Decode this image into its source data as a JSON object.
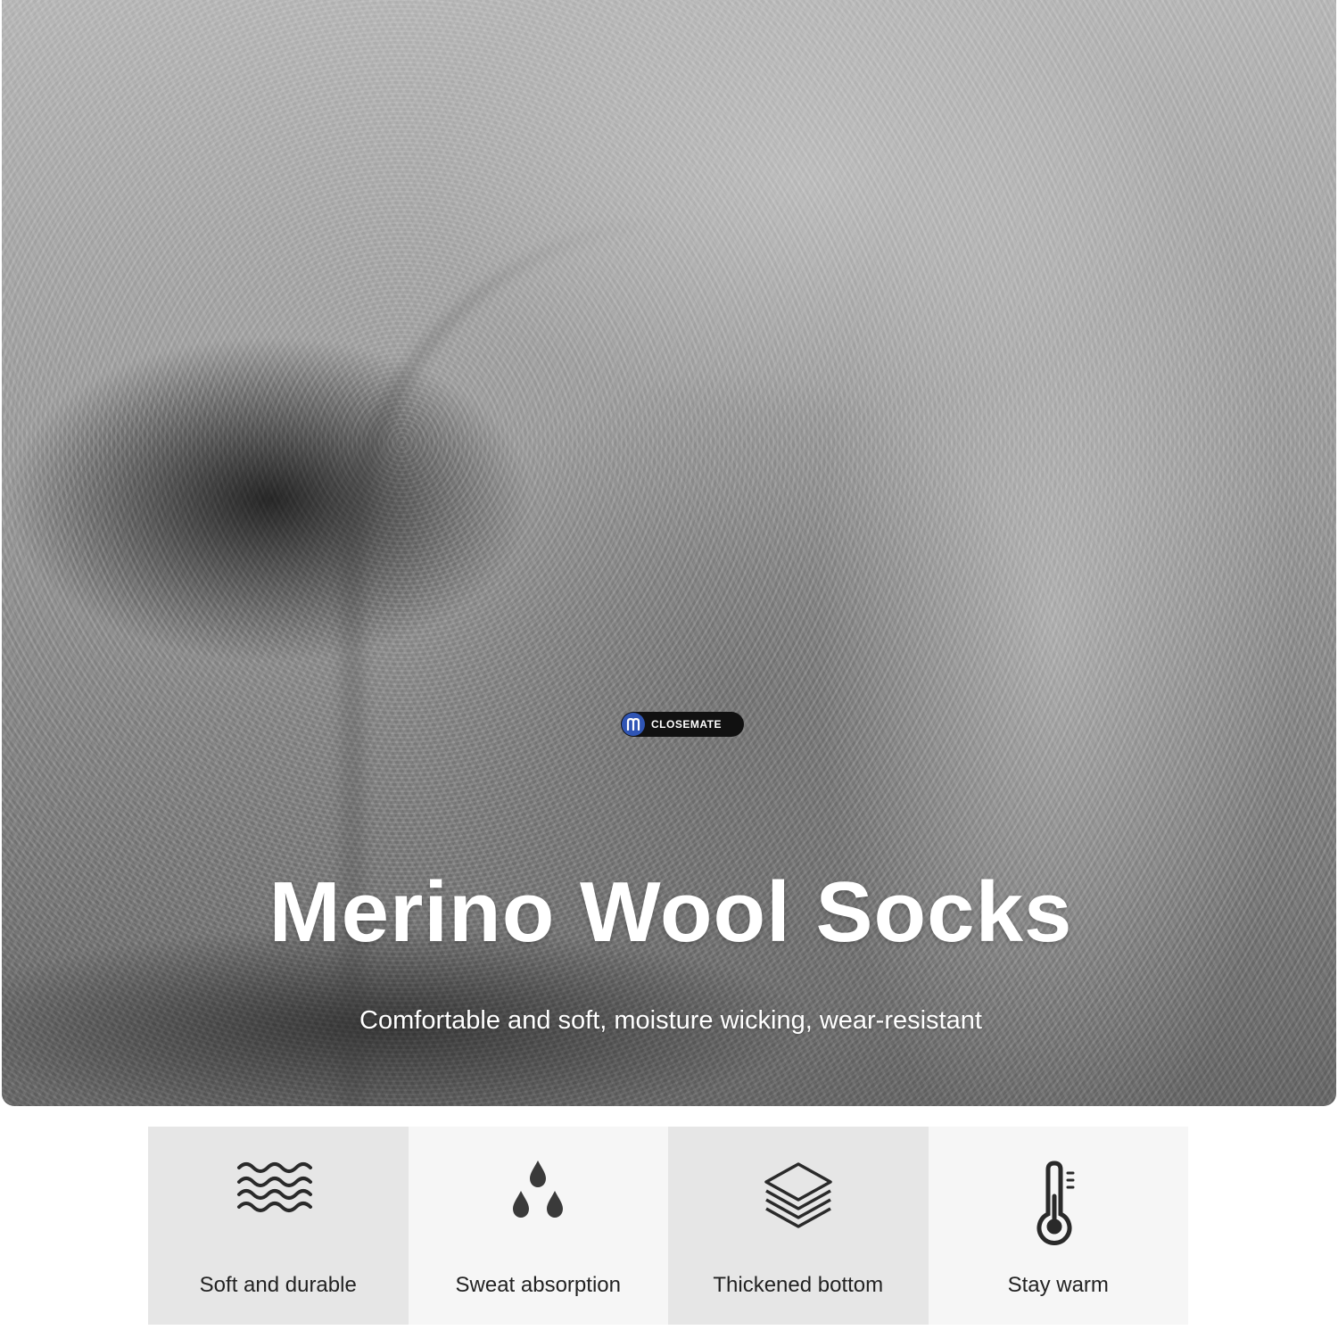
{
  "hero": {
    "logo_text": "CLOSEMATE",
    "title": "Merino Wool Socks",
    "subtitle": "Comfortable and soft, moisture wicking, wear-resistant"
  },
  "features": [
    {
      "label": "Soft and durable",
      "icon": "waves-icon"
    },
    {
      "label": "Sweat absorption",
      "icon": "droplets-icon"
    },
    {
      "label": "Thickened bottom",
      "icon": "layers-icon"
    },
    {
      "label": "Stay warm",
      "icon": "thermometer-icon"
    }
  ],
  "colors": {
    "logo_badge": "#111111",
    "logo_mark": "#2f55b5",
    "panel_dark": "#e6e6e6",
    "panel_light": "#f6f6f6",
    "text_dark": "#222222"
  }
}
